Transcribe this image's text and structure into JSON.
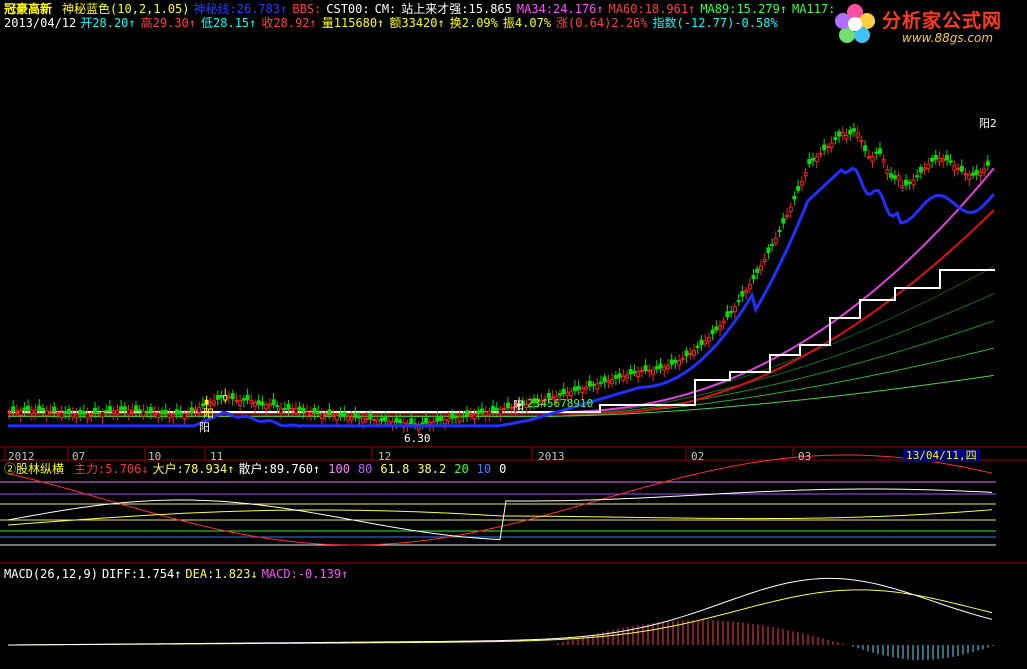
{
  "colors": {
    "bg": "#000000",
    "up": "#ff2020",
    "down": "#00e000",
    "special": "#ffff00",
    "ma_blue": "#2030ff",
    "ma_pink": "#e040e0",
    "ma_red": "#e01010",
    "stair": "#ffffff",
    "greens": [
      "#105810",
      "#187018",
      "#209020",
      "#30b030",
      "#50d050"
    ]
  },
  "header": {
    "stock_name": "冠豪高新",
    "indicator_name": "神秘蓝色",
    "indicator_params": "(10,2,1.05)",
    "line1_items": [
      {
        "label": "神秘线:",
        "value": "26.783",
        "arrow": "↑",
        "color": "#2040ff"
      },
      {
        "label": "BBS:",
        "value": "",
        "arrow": "",
        "color": "#ff4040"
      },
      {
        "label": "CST00:",
        "value": "",
        "arrow": "",
        "color": "#ffffff"
      },
      {
        "label": "CM:",
        "value": "",
        "arrow": "",
        "color": "#ffffff"
      },
      {
        "label": "站上来才强:",
        "value": "15.865",
        "arrow": "",
        "color": "#ffffff"
      },
      {
        "label": "MA34:",
        "value": "24.176",
        "arrow": "↑",
        "color": "#ff50ff"
      },
      {
        "label": "MA60:",
        "value": "18.961",
        "arrow": "↑",
        "color": "#ff4040"
      },
      {
        "label": "MA89:",
        "value": "15.279",
        "arrow": "↑",
        "color": "#40ff40"
      },
      {
        "label": "MA117:",
        "value": "",
        "arrow": "",
        "color": "#40ff40"
      }
    ]
  },
  "quote": {
    "date": "2013/04/12",
    "items": [
      {
        "label": "开",
        "value": "28.20",
        "arrow": "↑",
        "color": "#00ffff"
      },
      {
        "label": "高",
        "value": "29.30",
        "arrow": "↑",
        "color": "#ff4040"
      },
      {
        "label": "低",
        "value": "28.15",
        "arrow": "↑",
        "color": "#00ffff"
      },
      {
        "label": "收",
        "value": "28.92",
        "arrow": "↑",
        "color": "#ff4040"
      },
      {
        "label": "量",
        "value": "115680",
        "arrow": "↑",
        "color": "#ffff00"
      },
      {
        "label": "额",
        "value": "33420",
        "arrow": "↑",
        "color": "#ffff00"
      },
      {
        "label": "换",
        "value": "2.09%",
        "arrow": "",
        "color": "#ffff00"
      },
      {
        "label": "振",
        "value": "4.07%",
        "arrow": "",
        "color": "#ffff00"
      },
      {
        "label": "涨",
        "value": "(0.64)2.26%",
        "arrow": "",
        "color": "#ff4040"
      },
      {
        "label": "指数",
        "value": "(-12.77)-0.58%",
        "arrow": "",
        "color": "#00ffff"
      }
    ]
  },
  "logo": {
    "brand": "分析家公式网",
    "url": "www.88gs.com"
  },
  "annotations": {
    "yang_label": "阳",
    "yang2_label": "阳2",
    "sequence_label": "2345678910",
    "low_price": "6.30"
  },
  "x_axis": {
    "labels": [
      "2012",
      "07",
      "10",
      "11",
      "12",
      "2013",
      "02",
      "03"
    ],
    "cursor_date": "13/04/11,四"
  },
  "sub1": {
    "title": "②股林纵横",
    "items": [
      {
        "label": "主力:",
        "value": "5.706",
        "arrow": "↓",
        "color": "#ff3030"
      },
      {
        "label": "大户:",
        "value": "78.934",
        "arrow": "↑",
        "color": "#ffff40"
      },
      {
        "label": "散户:",
        "value": "89.760",
        "arrow": "↑",
        "color": "#ffffff"
      }
    ],
    "levels": [
      {
        "value": "100",
        "color": "#ff80ff"
      },
      {
        "value": "80",
        "color": "#b060ff"
      },
      {
        "value": "61.8",
        "color": "#ffff60"
      },
      {
        "value": "38.2",
        "color": "#ffff60"
      },
      {
        "value": "20",
        "color": "#40ff40"
      },
      {
        "value": "10",
        "color": "#4080ff"
      },
      {
        "value": "0",
        "color": "#ffffff"
      }
    ]
  },
  "sub2": {
    "title": "MACD",
    "params": "(26,12,9)",
    "items": [
      {
        "label": "DIFF:",
        "value": "1.754",
        "arrow": "↑",
        "color": "#ffffff"
      },
      {
        "label": "DEA:",
        "value": "1.823",
        "arrow": "↓",
        "color": "#ffff40"
      },
      {
        "label": "MACD:",
        "value": "-0.139",
        "arrow": "↑",
        "color": "#ff50ff"
      }
    ]
  }
}
